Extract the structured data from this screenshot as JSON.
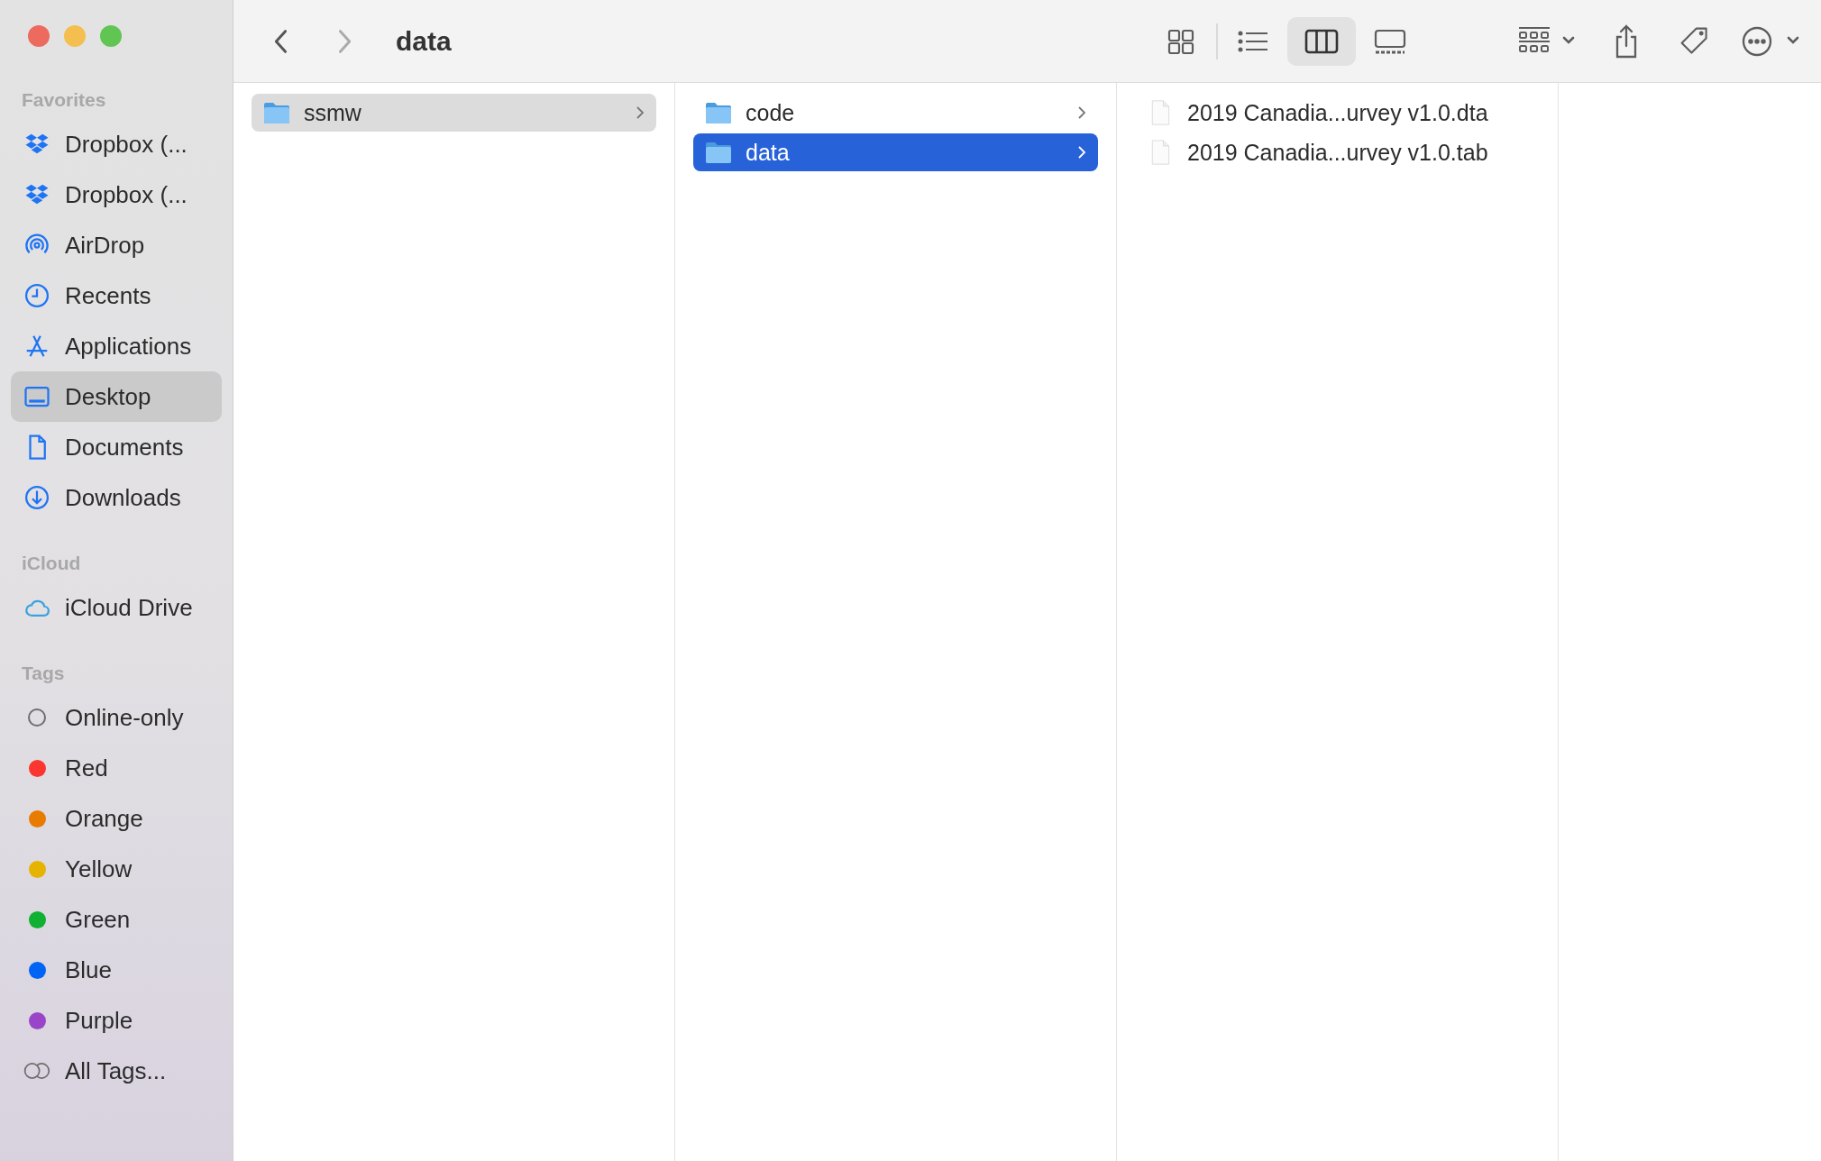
{
  "toolbar": {
    "title": "data",
    "views": [
      {
        "kind": "icons",
        "selected": false
      },
      {
        "kind": "list",
        "selected": false
      },
      {
        "kind": "columns",
        "selected": true
      },
      {
        "kind": "gallery",
        "selected": false
      }
    ]
  },
  "sidebar": {
    "sections": [
      {
        "title": "Favorites",
        "items": [
          {
            "label": "Dropbox (...",
            "kind": "dropbox",
            "selected": false
          },
          {
            "label": "Dropbox (...",
            "kind": "dropbox",
            "selected": false
          },
          {
            "label": "AirDrop",
            "kind": "airdrop",
            "selected": false
          },
          {
            "label": "Recents",
            "kind": "clock",
            "selected": false
          },
          {
            "label": "Applications",
            "kind": "apps",
            "selected": false
          },
          {
            "label": "Desktop",
            "kind": "desktop",
            "selected": true
          },
          {
            "label": "Documents",
            "kind": "document",
            "selected": false
          },
          {
            "label": "Downloads",
            "kind": "download",
            "selected": false
          }
        ]
      },
      {
        "title": "iCloud",
        "items": [
          {
            "label": "iCloud Drive",
            "kind": "cloud",
            "selected": false
          }
        ]
      }
    ],
    "tags_title": "Tags",
    "tags": [
      {
        "label": "Online-only",
        "kind": "ring"
      },
      {
        "label": "Red",
        "kind": "dot",
        "color": "#fb3530"
      },
      {
        "label": "Orange",
        "kind": "dot",
        "color": "#e87c00"
      },
      {
        "label": "Yellow",
        "kind": "dot",
        "color": "#e6b300"
      },
      {
        "label": "Green",
        "kind": "dot",
        "color": "#10b032"
      },
      {
        "label": "Blue",
        "kind": "dot",
        "color": "#0064f5"
      },
      {
        "label": "Purple",
        "kind": "dot",
        "color": "#9a45c9"
      },
      {
        "label": "All Tags...",
        "kind": "all"
      }
    ]
  },
  "columns": [
    {
      "items": [
        {
          "name": "ssmw",
          "kind": "folder",
          "selected": true,
          "focused": false
        }
      ]
    },
    {
      "items": [
        {
          "name": "code",
          "kind": "folder",
          "selected": false
        },
        {
          "name": "data",
          "kind": "folder",
          "selected": true,
          "focused": true
        }
      ]
    },
    {
      "items": [
        {
          "name": "2019 Canadia...urvey v1.0.dta",
          "kind": "file",
          "selected": false
        },
        {
          "name": "2019 Canadia...urvey v1.0.tab",
          "kind": "file",
          "selected": false
        }
      ]
    }
  ]
}
